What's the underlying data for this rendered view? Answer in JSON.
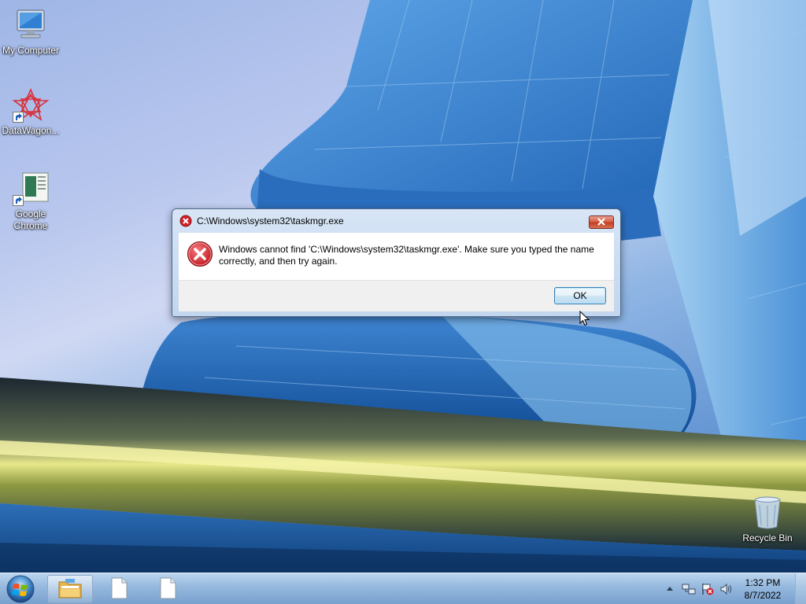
{
  "desktop": {
    "icons": [
      {
        "label": "My Computer",
        "icon": "computer-icon"
      },
      {
        "label": "DataWagon...",
        "icon": "datawagon-icon"
      },
      {
        "label": "Google Chrome",
        "icon": "chrome-icon"
      },
      {
        "label": "Recycle Bin",
        "icon": "recycle-bin-icon"
      }
    ]
  },
  "dialog": {
    "title": "C:\\Windows\\system32\\taskmgr.exe",
    "message": "Windows cannot find 'C:\\Windows\\system32\\taskmgr.exe'. Make sure you typed the name correctly, and then try again.",
    "ok_label": "OK",
    "icon": "error-icon"
  },
  "taskbar": {
    "start_icon": "windows-start-icon",
    "buttons": [
      {
        "icon": "file-explorer-icon",
        "active": true
      },
      {
        "icon": "blank-document-icon",
        "active": false
      },
      {
        "icon": "blank-document-icon",
        "active": false
      }
    ],
    "tray_icons": [
      "chevron-up-icon",
      "network-icon",
      "action-center-flag-icon",
      "speaker-icon"
    ]
  },
  "clock": {
    "time": "1:32 PM",
    "date": "8/7/2022"
  }
}
